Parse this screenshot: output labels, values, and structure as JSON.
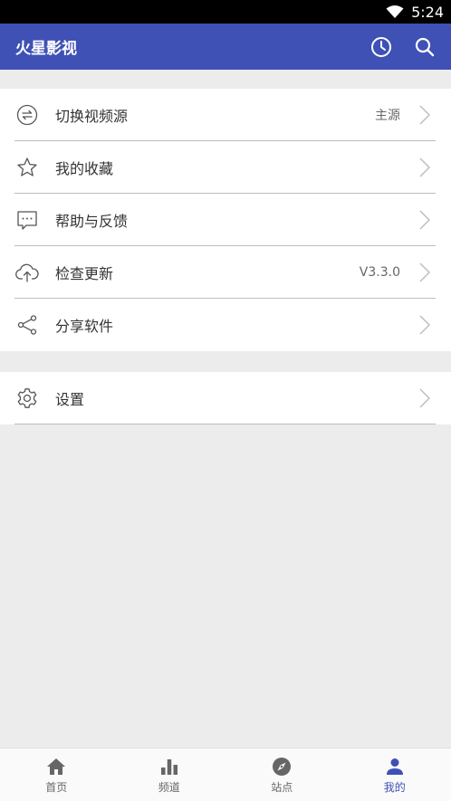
{
  "status_bar": {
    "time": "5:24"
  },
  "app_bar": {
    "title": "火星影视"
  },
  "menu_groups": [
    [
      {
        "label": "切换视频源",
        "value": "主源",
        "icon": "switch-icon"
      },
      {
        "label": "我的收藏",
        "value": "",
        "icon": "star-icon"
      },
      {
        "label": "帮助与反馈",
        "value": "",
        "icon": "feedback-icon"
      },
      {
        "label": "检查更新",
        "value": "V3.3.0",
        "icon": "cloud-upload-icon"
      },
      {
        "label": "分享软件",
        "value": "",
        "icon": "share-icon"
      }
    ],
    [
      {
        "label": "设置",
        "value": "",
        "icon": "gear-icon"
      }
    ]
  ],
  "bottom_nav": [
    {
      "label": "首页",
      "icon": "home-icon",
      "active": false
    },
    {
      "label": "频道",
      "icon": "bar-chart-icon",
      "active": false
    },
    {
      "label": "站点",
      "icon": "compass-icon",
      "active": false
    },
    {
      "label": "我的",
      "icon": "person-icon",
      "active": true
    }
  ],
  "colors": {
    "primary": "#3f51b5",
    "background": "#ececec"
  }
}
